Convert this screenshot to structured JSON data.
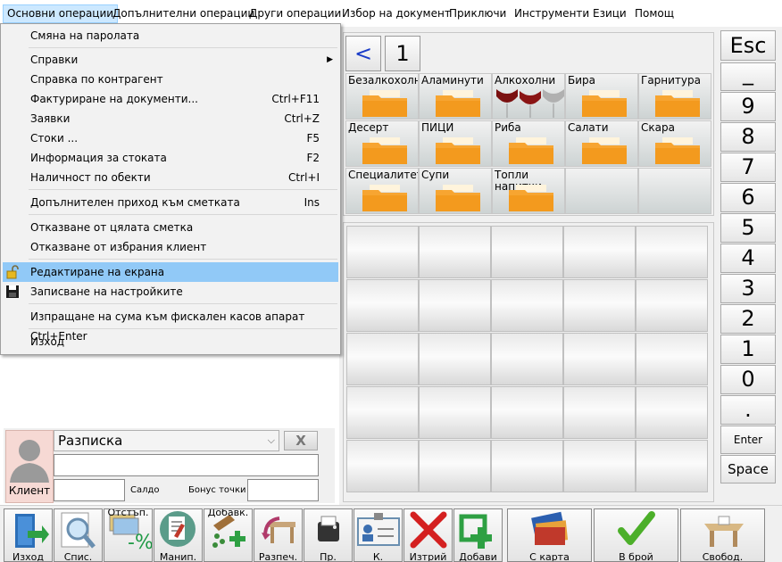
{
  "menubar": {
    "items": [
      "Основни операции",
      "Допълнителни операции",
      "Други операции",
      "Избор на документ",
      "Приключи",
      "Инструменти",
      "Езици",
      "Помощ"
    ]
  },
  "dropdown": {
    "items": [
      {
        "label": "Смяна на паролата",
        "shortcut": ""
      },
      {
        "label": "Справки",
        "shortcut": ""
      },
      {
        "label": "Справка по контрагент",
        "shortcut": ""
      },
      {
        "label": "Фактуриране на документи...",
        "shortcut": "Ctrl+F11"
      },
      {
        "label": "Заявки",
        "shortcut": "Ctrl+Z"
      },
      {
        "label": "Стоки ...",
        "shortcut": "F5"
      },
      {
        "label": "Информация за стоката",
        "shortcut": "F2"
      },
      {
        "label": "Наличност по обекти",
        "shortcut": "Ctrl+I"
      },
      {
        "label": "Допълнителен приход към сметката",
        "shortcut": "Ins"
      },
      {
        "label": "Отказване от цялата сметка",
        "shortcut": ""
      },
      {
        "label": "Отказване от избрания клиент",
        "shortcut": ""
      },
      {
        "label": "Редактиране на екрана",
        "shortcut": ""
      },
      {
        "label": "Записване на настройките",
        "shortcut": ""
      },
      {
        "label": "Изпращане на сума към фискален касов апарат Ctrl+Enter",
        "shortcut": ""
      },
      {
        "label": "Изход",
        "shortcut": ""
      }
    ]
  },
  "nav": {
    "back": "<",
    "page": "1"
  },
  "categories": [
    "Безалкохолни",
    "Аламинути",
    "Алкохолни",
    "Бира",
    "Гарнитура",
    "Десерт",
    "ПИЦИ",
    "Риба",
    "Салати",
    "Скара",
    "Специалитети",
    "Супи",
    "Топли напитки"
  ],
  "client": {
    "doc_type": "Разписка",
    "clear": "X",
    "label": "Клиент",
    "saldo": "Салдо",
    "bonus": "Бонус точки"
  },
  "keypad": [
    "Esc",
    "_",
    "9",
    "8",
    "7",
    "6",
    "5",
    "4",
    "3",
    "2",
    "1",
    "0",
    ".",
    "Enter",
    "Space"
  ],
  "toolbar": [
    "Изход",
    "Спис.",
    "Отстъп.",
    "Манип.",
    "Добавк.",
    "Разпеч.",
    "Пр.",
    "К.",
    "Изтрий",
    "Добави",
    "С карта",
    "В брой",
    "Свобод."
  ],
  "colors": {
    "highlight": "#91c9f7",
    "menu_active": "#cce8ff",
    "folder": "#f7a531",
    "client_bg": "#f6d9d4"
  }
}
